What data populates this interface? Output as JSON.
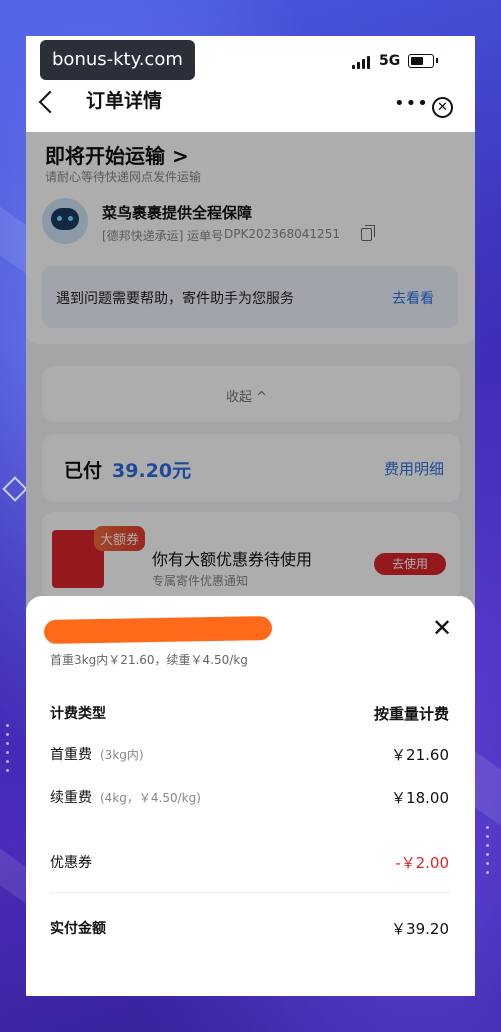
{
  "watermark": "bonus-kty.com",
  "status_bar": {
    "network": "5G"
  },
  "navbar": {
    "title": "订单详情",
    "more": "•••",
    "close": "✕"
  },
  "shipment": {
    "title": "即将开始运输 >",
    "subtitle": "请耐心等待快递网点发件运输",
    "guarantee": "菜鸟裹裹提供全程保障",
    "carrier": "[德邦快递承运] 运单号",
    "tracking_number": "DPK202368041251"
  },
  "help": {
    "text": "遇到问题需要帮助，寄件助手为您服务",
    "link": "去看看"
  },
  "collapse_label": "收起 ^",
  "payment": {
    "label": "已付",
    "amount": "39.20元",
    "details_link": "费用明细"
  },
  "coupon": {
    "badge": "大额券",
    "title": "你有大额优惠券待使用",
    "subtitle": "专属寄件优惠通知",
    "button": "去使用"
  },
  "fee_sheet": {
    "subtitle": "首重3kg内￥21.60，续重￥4.50/kg",
    "close": "✕",
    "header_label": "计费类型",
    "header_value": "按重量计费",
    "rows": [
      {
        "label": "首重费",
        "note": "(3kg内)",
        "value": "￥21.60"
      },
      {
        "label": "续重费",
        "note": "(4kg，￥4.50/kg)",
        "value": "￥18.00"
      },
      {
        "label": "优惠券",
        "note": "",
        "value": "-￥2.00"
      }
    ],
    "total_label": "实付金额",
    "total_value": "￥39.20"
  },
  "colors": {
    "accent_blue": "#2f6ee0",
    "accent_red": "#d9262b",
    "redaction_orange": "#ff6a1a"
  }
}
